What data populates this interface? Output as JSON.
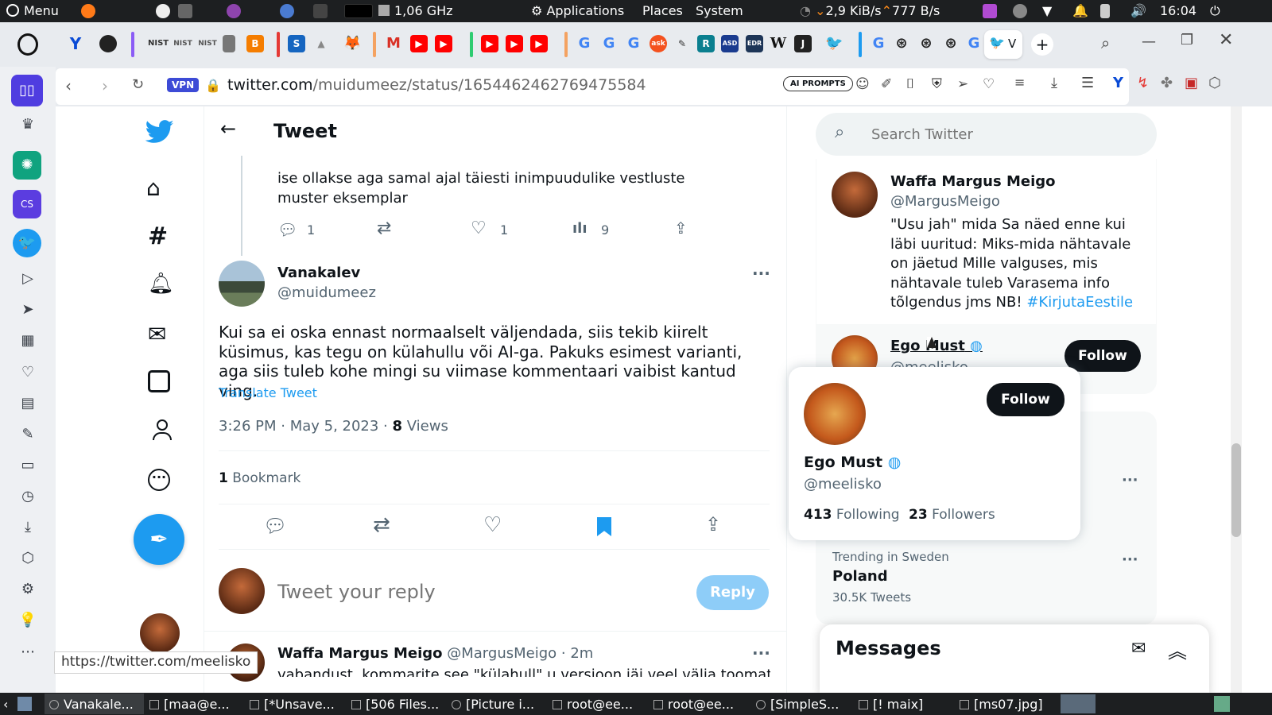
{
  "system": {
    "menu": "Menu",
    "cpu": "1,06 GHz",
    "applications": "Applications",
    "places": "Places",
    "system": "System",
    "net": "2,9 KiB/s",
    "net_up": "777 B/s",
    "clock": "16:04"
  },
  "taskbar": [
    "Vanakale...",
    "[maa@e...",
    "[*Unsave...",
    "[506 Files...",
    "[Picture i...",
    "root@ee...",
    "root@ee...",
    "[SimpleS...",
    "[! maix]",
    "[ms07.jpg]"
  ],
  "browser": {
    "vpn": "VPN",
    "url_host": "twitter.com",
    "url_path": "/muidumeez/status/1654462462769475584",
    "ai_prompts": "AI PROMPTS",
    "status_url": "https://twitter.com/meelisko"
  },
  "header": {
    "title": "Tweet"
  },
  "prev_tweet": {
    "text": "ise ollakse aga samal ajal täiesti inimpuudulike vestluste muster eksemplar",
    "replies": "1",
    "likes": "1",
    "views": "9"
  },
  "tweet": {
    "name": "Vanakalev",
    "handle": "@muidumeez",
    "text": "Kui sa ei oska ennast normaalselt väljendada, siis tekib kiirelt küsimus, kas tegu on külahullu või AI-ga. Pakuks esimest varianti, aga siis tuleb kohe mingi su viimase kommentaari vaibist kantud ving.",
    "translate": "Translate Tweet",
    "time": "3:26 PM · May 5, 2023 · ",
    "views_count": "8",
    "views_label": "Views",
    "bookmarks_count": "1",
    "bookmarks_label": "Bookmark"
  },
  "reply_box": {
    "placeholder": "Tweet your reply",
    "button": "Reply"
  },
  "next_tweet": {
    "name": "Waffa Margus Meigo",
    "handle": "@MargusMeigo · 2m",
    "text": "vabandust, kommarite see \"külahull\" u versioon jäi veel välja toomata, see"
  },
  "search": {
    "placeholder": "Search Twitter"
  },
  "right": {
    "card_name": "Waffa Margus Meigo",
    "card_handle": "@MargusMeigo",
    "card_text": "\"Usu jah\" mida Sa näed enne kui läbi uuritud: Miks-mida nähtavale on jäetud Mille valguses, mis nähtavale tuleb Varasema info tõlgendus jms NB! ",
    "card_hashtag": "#KirjutaEestile",
    "ego_name": "Ego Must",
    "ego_handle": "@meelisko",
    "follow": "Follow"
  },
  "hover": {
    "name": "Ego Must",
    "handle": "@meelisko",
    "following_count": "413",
    "following_label": "Following",
    "followers_count": "23",
    "followers_label": "Followers",
    "follow": "Follow"
  },
  "trending": {
    "label": "Trending in Sweden",
    "topic": "Poland",
    "count": "30.5K Tweets"
  },
  "messages": {
    "title": "Messages"
  },
  "colors": {
    "blue": "#1d9bf0",
    "dark": "#0f1419",
    "muted": "#536471",
    "topbar": "#1d1f21"
  }
}
